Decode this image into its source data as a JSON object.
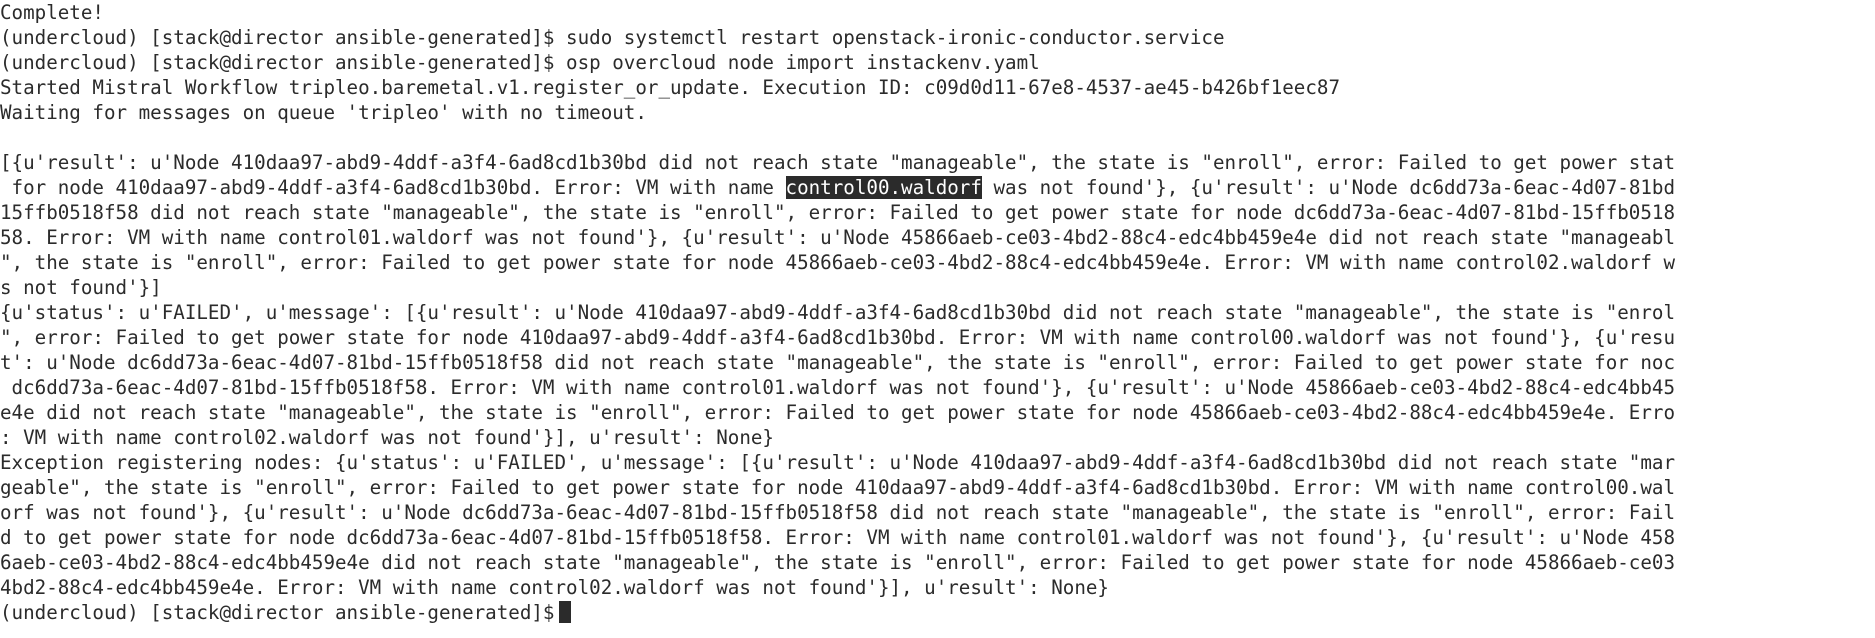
{
  "terminal": {
    "lines": [
      "Complete!",
      "(undercloud) [stack@director ansible-generated]$ sudo systemctl restart openstack-ironic-conductor.service",
      "(undercloud) [stack@director ansible-generated]$ osp overcloud node import instackenv.yaml",
      "Started Mistral Workflow tripleo.baremetal.v1.register_or_update. Execution ID: c09d0d11-67e8-4537-ae45-b426bf1eec87",
      "Waiting for messages on queue 'tripleo' with no timeout.",
      "",
      "[{u'result': u'Node 410daa97-abd9-4ddf-a3f4-6ad8cd1b30bd did not reach state \"manageable\", the state is \"enroll\", error: Failed to get power stat",
      {
        "before": " for node 410daa97-abd9-4ddf-a3f4-6ad8cd1b30bd. Error: VM with name ",
        "selected": "control00.waldorf",
        "after": " was not found'}, {u'result': u'Node dc6dd73a-6eac-4d07-81bd"
      },
      "15ffb0518f58 did not reach state \"manageable\", the state is \"enroll\", error: Failed to get power state for node dc6dd73a-6eac-4d07-81bd-15ffb0518",
      "58. Error: VM with name control01.waldorf was not found'}, {u'result': u'Node 45866aeb-ce03-4bd2-88c4-edc4bb459e4e did not reach state \"manageabl",
      "\", the state is \"enroll\", error: Failed to get power state for node 45866aeb-ce03-4bd2-88c4-edc4bb459e4e. Error: VM with name control02.waldorf w",
      "s not found'}]",
      "{u'status': u'FAILED', u'message': [{u'result': u'Node 410daa97-abd9-4ddf-a3f4-6ad8cd1b30bd did not reach state \"manageable\", the state is \"enrol",
      "\", error: Failed to get power state for node 410daa97-abd9-4ddf-a3f4-6ad8cd1b30bd. Error: VM with name control00.waldorf was not found'}, {u'resu",
      "t': u'Node dc6dd73a-6eac-4d07-81bd-15ffb0518f58 did not reach state \"manageable\", the state is \"enroll\", error: Failed to get power state for noc",
      " dc6dd73a-6eac-4d07-81bd-15ffb0518f58. Error: VM with name control01.waldorf was not found'}, {u'result': u'Node 45866aeb-ce03-4bd2-88c4-edc4bb45",
      "e4e did not reach state \"manageable\", the state is \"enroll\", error: Failed to get power state for node 45866aeb-ce03-4bd2-88c4-edc4bb459e4e. Erro",
      ": VM with name control02.waldorf was not found'}], u'result': None}",
      "Exception registering nodes: {u'status': u'FAILED', u'message': [{u'result': u'Node 410daa97-abd9-4ddf-a3f4-6ad8cd1b30bd did not reach state \"mar",
      "geable\", the state is \"enroll\", error: Failed to get power state for node 410daa97-abd9-4ddf-a3f4-6ad8cd1b30bd. Error: VM with name control00.wal",
      "orf was not found'}, {u'result': u'Node dc6dd73a-6eac-4d07-81bd-15ffb0518f58 did not reach state \"manageable\", the state is \"enroll\", error: Fail",
      "d to get power state for node dc6dd73a-6eac-4d07-81bd-15ffb0518f58. Error: VM with name control01.waldorf was not found'}, {u'result': u'Node 458",
      "6aeb-ce03-4bd2-88c4-edc4bb459e4e did not reach state \"manageable\", the state is \"enroll\", error: Failed to get power state for node 45866aeb-ce03",
      "4bd2-88c4-edc4bb459e4e. Error: VM with name control02.waldorf was not found'}], u'result': None}",
      {
        "prompt": "(undercloud) [stack@director ansible-generated]$ ",
        "cursor": true
      }
    ]
  }
}
